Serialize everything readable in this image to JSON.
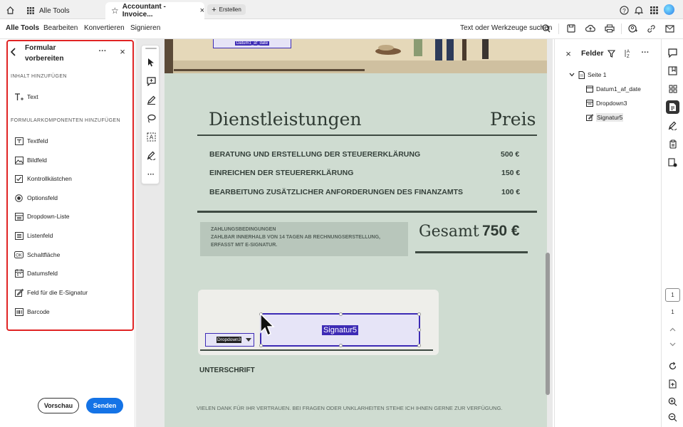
{
  "tabs": {
    "all_tools": "Alle Tools",
    "active": "Accountant - Invoice...",
    "create": "Erstellen"
  },
  "menu": {
    "all_tools": "Alle Tools",
    "edit": "Bearbeiten",
    "convert": "Konvertieren",
    "sign": "Signieren",
    "search": "Text oder Werkzeuge suchen"
  },
  "left_panel": {
    "title_line1": "Formular",
    "title_line2": "vorbereiten",
    "section_content": "INHALT HINZUFÜGEN",
    "text_item": "Text",
    "section_components": "FORMULARKOMPONENTEN HINZUFÜGEN",
    "items": [
      "Textfeld",
      "Bildfeld",
      "Kontrollkästchen",
      "Optionsfeld",
      "Dropdown-Liste",
      "Listenfeld",
      "Schaltfläche",
      "Datumsfeld",
      "Feld für die E-Signatur",
      "Barcode"
    ],
    "preview": "Vorschau",
    "send": "Senden"
  },
  "doc": {
    "date_field": "Datum1_af_date",
    "services": "Dienstleistungen",
    "price": "Preis",
    "rows": [
      {
        "label": "BERATUNG UND ERSTELLUNG DER STEUERERKLÄRUNG",
        "amount": "500 €"
      },
      {
        "label": "EINREICHEN DER STEUERERKLÄRUNG",
        "amount": "150 €"
      },
      {
        "label": "BEARBEITUNG ZUSÄTZLICHER ANFORDERUNGEN DES FINANZAMTS",
        "amount": "100 €"
      }
    ],
    "terms_title": "ZAHLUNGSBEDINGUNGEN",
    "terms_line1": "ZAHLBAR INNERHALB VON 14 TAGEN AB RECHNUNGSERSTELLUNG,",
    "terms_line2": "ERFASST MIT E-SIGNATUR.",
    "total_label": "Gesamt",
    "total_value": "750 €",
    "dropdown_field": "Dropdown3",
    "signature_field": "Signatur5",
    "signature_label": "UNTERSCHRIFT",
    "footer": "VIELEN DANK FÜR IHR VERTRAUEN. BEI FRAGEN ODER UNKLARHEITEN STEHE ICH IHNEN GERNE ZUR VERFÜGUNG."
  },
  "right_panel": {
    "title": "Felder",
    "page": "Seite 1",
    "fields": [
      "Datum1_af_date",
      "Dropdown3",
      "Signatur5"
    ]
  },
  "pager": {
    "current": "1",
    "total": "1"
  },
  "colors": {
    "highlight": "#e02424",
    "accent": "#1473e6",
    "field_border": "#3d2bb5"
  }
}
